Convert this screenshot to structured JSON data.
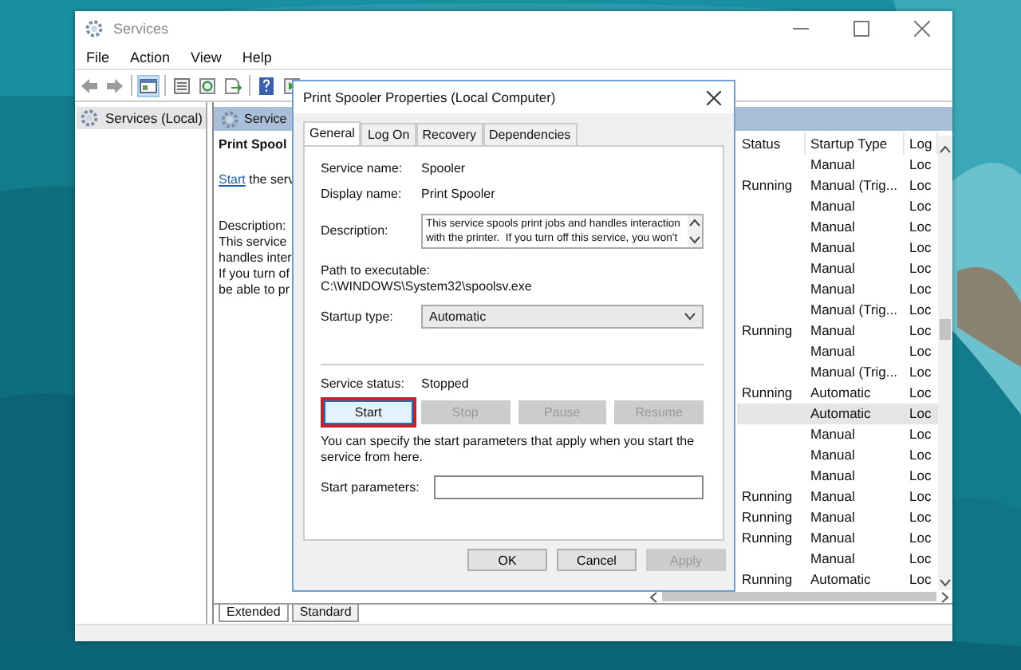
{
  "window": {
    "title": "Services",
    "menu": [
      "File",
      "Action",
      "View",
      "Help"
    ]
  },
  "tree": [
    {
      "label": "Services (Local)",
      "selected": true
    }
  ],
  "details": {
    "header": "Service",
    "title": "Print Spool",
    "link": "Start",
    "link_rest": "the serv",
    "lines": [
      "Description:",
      "This service",
      "handles inter",
      "If you turn of",
      "be able to pr"
    ]
  },
  "table": {
    "columns": [
      "Status",
      "Startup Type",
      "Log"
    ],
    "rows": [
      {
        "startup": "Manual",
        "log": "Loc",
        "selected": false
      },
      {
        "status": "Running",
        "startup": "Manual (Trig...",
        "log": "Loc",
        "selected": false
      },
      {
        "startup": "Manual",
        "log": "Loc",
        "selected": false
      },
      {
        "startup": "Manual",
        "log": "Loc",
        "selected": false
      },
      {
        "startup": "Manual",
        "log": "Loc",
        "selected": false
      },
      {
        "startup": "Manual",
        "log": "Loc",
        "selected": false
      },
      {
        "startup": "Manual",
        "log": "Loc",
        "selected": false
      },
      {
        "startup": "Manual (Trig...",
        "log": "Loc",
        "selected": false
      },
      {
        "status": "Running",
        "startup": "Manual",
        "log": "Loc",
        "selected": false
      },
      {
        "startup": "Manual",
        "log": "Loc",
        "selected": false
      },
      {
        "startup": "Manual (Trig...",
        "log": "Loc",
        "selected": false
      },
      {
        "status": "Running",
        "startup": "Automatic",
        "log": "Loc",
        "selected": false
      },
      {
        "startup": "Automatic",
        "log": "Loc",
        "selected": true
      },
      {
        "startup": "Manual",
        "log": "Loc",
        "selected": false
      },
      {
        "startup": "Manual",
        "log": "Loc",
        "selected": false
      },
      {
        "startup": "Manual",
        "log": "Loc",
        "selected": false
      },
      {
        "status": "Running",
        "startup": "Manual",
        "log": "Loc",
        "selected": false
      },
      {
        "status": "Running",
        "startup": "Manual",
        "log": "Loc",
        "selected": false
      },
      {
        "status": "Running",
        "startup": "Manual",
        "log": "Loc",
        "selected": false
      },
      {
        "startup": "Manual",
        "log": "Loc",
        "selected": false
      },
      {
        "status": "Running",
        "startup": "Automatic",
        "log": "Loc",
        "selected": false
      }
    ]
  },
  "view_tabs": [
    {
      "label": "Extended",
      "selected": true
    },
    {
      "label": "Standard",
      "selected": false
    }
  ],
  "dialog": {
    "title": "Print Spooler Properties (Local Computer)",
    "tabs": [
      {
        "label": "General",
        "selected": true
      },
      {
        "label": "Log On",
        "selected": false
      },
      {
        "label": "Recovery",
        "selected": false
      },
      {
        "label": "Dependencies",
        "selected": false
      }
    ],
    "service_name": {
      "label": "Service name:",
      "value": "Spooler"
    },
    "display_name": {
      "label": "Display name:",
      "value": "Print Spooler"
    },
    "description": {
      "label": "Description:",
      "lines": [
        "This service spools print jobs and handles interaction",
        "with the printer.  If you turn off this service, you won't"
      ]
    },
    "path": {
      "label": "Path to executable:",
      "value": "C:\\WINDOWS\\System32\\spoolsv.exe"
    },
    "startup_type": {
      "label": "Startup type:",
      "value": "Automatic"
    },
    "service_status": {
      "label": "Service status:",
      "value": "Stopped"
    },
    "control_buttons": [
      {
        "label": "Start",
        "disabled": false,
        "highlighted": true
      },
      {
        "label": "Stop",
        "disabled": true,
        "highlighted": false
      },
      {
        "label": "Pause",
        "disabled": true,
        "highlighted": false
      },
      {
        "label": "Resume",
        "disabled": true,
        "highlighted": false
      }
    ],
    "hint": "You can specify the start parameters that apply when you start the service from here.",
    "start_parameters": {
      "label": "Start parameters:"
    },
    "buttons": [
      {
        "label": "OK",
        "disabled": false
      },
      {
        "label": "Cancel",
        "disabled": false
      },
      {
        "label": "Apply",
        "disabled": true
      }
    ]
  }
}
